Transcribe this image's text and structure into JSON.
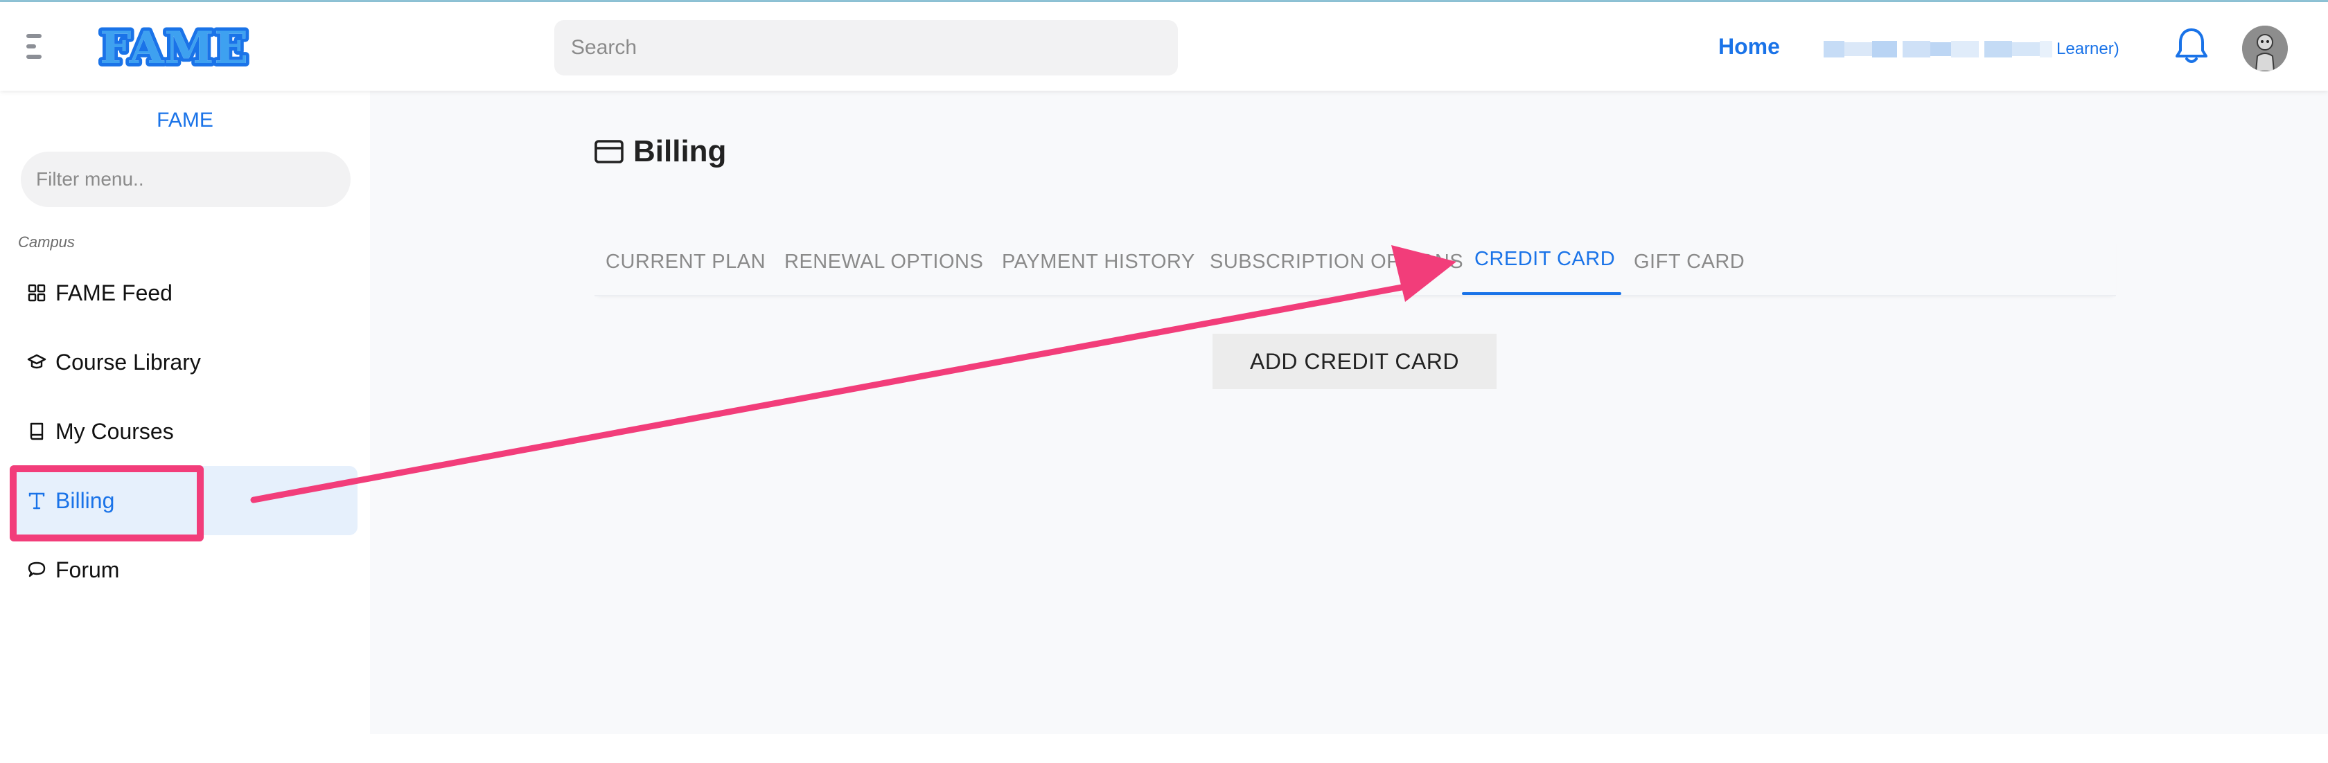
{
  "app": {
    "logo_text": "FAME",
    "brand_color": "#1a73e8",
    "accent_annotation_color": "#f23d7a"
  },
  "header": {
    "search_placeholder": "Search",
    "nav_home": "Home",
    "user_role_suffix": "Learner)",
    "icons": [
      "menu-icon",
      "bell-icon",
      "avatar"
    ]
  },
  "sidebar": {
    "title": "FAME",
    "filter_placeholder": "Filter menu..",
    "section_label": "Campus",
    "items": [
      {
        "label": "FAME Feed",
        "icon": "grid-icon",
        "active": false
      },
      {
        "label": "Course Library",
        "icon": "graduation-cap-icon",
        "active": false
      },
      {
        "label": "My Courses",
        "icon": "book-icon",
        "active": false
      },
      {
        "label": "Billing",
        "icon": "type-icon",
        "active": true
      },
      {
        "label": "Forum",
        "icon": "chat-bubble-icon",
        "active": false
      }
    ]
  },
  "main": {
    "title": "Billing",
    "title_icon": "credit-card-icon",
    "tabs": [
      {
        "label": "CURRENT PLAN",
        "active": false
      },
      {
        "label": "RENEWAL OPTIONS",
        "active": false
      },
      {
        "label": "PAYMENT HISTORY",
        "active": false
      },
      {
        "label": "SUBSCRIPTION OPTIONS",
        "active": false
      },
      {
        "label": "CREDIT CARD",
        "active": true
      },
      {
        "label": "GIFT CARD",
        "active": false
      }
    ],
    "add_button_label": "ADD CREDIT CARD"
  }
}
